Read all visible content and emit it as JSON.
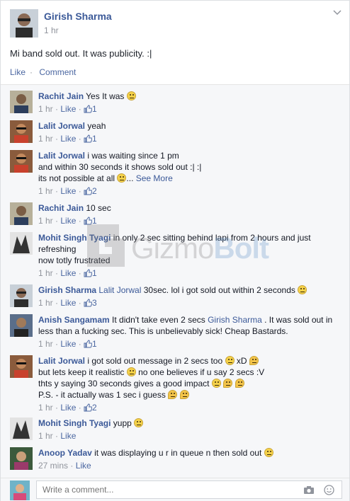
{
  "post": {
    "author": "Girish Sharma",
    "time": "1 hr",
    "text": "Mi band sold out. It was publicity. :|",
    "like_label": "Like",
    "comment_label": "Comment"
  },
  "comments": [
    {
      "name": "Rachit Jain",
      "text": "Yes It was",
      "time": "1 hr",
      "like": "Like",
      "likes": "1"
    },
    {
      "name": "Lalit Jorwal",
      "text": "yeah",
      "time": "1 hr",
      "like": "Like",
      "likes": "1"
    },
    {
      "name": "Lalit Jorwal",
      "text1": "i was waiting since 1 pm",
      "text2": "and within 30 seconds it shows sold out :| :|",
      "text3": "its not possible at all",
      "see_more": "See More",
      "time": "1 hr",
      "like": "Like",
      "likes": "2"
    },
    {
      "name": "Rachit Jain",
      "text": "10 sec",
      "time": "1 hr",
      "like": "Like",
      "likes": "1"
    },
    {
      "name": "Mohit Singh Tyagi",
      "text1": "in only 2 sec sitting behind lapi from 2 hours and just",
      "text2": "refreshing",
      "text3": "now totly frustrated",
      "time": "1 hr",
      "like": "Like",
      "likes": "1"
    },
    {
      "name": "Girish Sharma",
      "mention": "Lalit Jorwal",
      "text": "30sec. lol i got sold out within 2 seconds",
      "time": "1 hr",
      "like": "Like",
      "likes": "3"
    },
    {
      "name": "Anish Sangamam",
      "text1": "It didn't take even 2 secs",
      "mention": "Girish Sharma",
      "text1b": ". It was sold out in",
      "text2": "less than a fucking sec. This is unbelievably sick! Cheap Bastards.",
      "time": "1 hr",
      "like": "Like",
      "likes": "1"
    },
    {
      "name": "Lalit Jorwal",
      "text1": "i got sold out message in 2 secs too",
      "text1b": "xD",
      "text2": "but lets keep it realistic",
      "text2b": "no one believes if u say 2 secs :V",
      "text3": "thts y saying 30 seconds gives a good impact",
      "text4": "P.S. - it actually was 1 sec i guess",
      "time": "1 hr",
      "like": "Like",
      "likes": "2"
    },
    {
      "name": "Mohit Singh Tyagi",
      "text": "yupp",
      "time": "1 hr",
      "like": "Like"
    },
    {
      "name": "Anoop Yadav",
      "text": "it was displaying u r in queue n then sold out",
      "time": "27 mins",
      "like": "Like"
    }
  ],
  "composer": {
    "placeholder": "Write a comment..."
  },
  "watermark": {
    "text1": "Gizmo",
    "text2": "Bolt"
  },
  "colors": {
    "link": "#3b5998",
    "meta": "#90949c",
    "bg": "#f6f7f9"
  }
}
